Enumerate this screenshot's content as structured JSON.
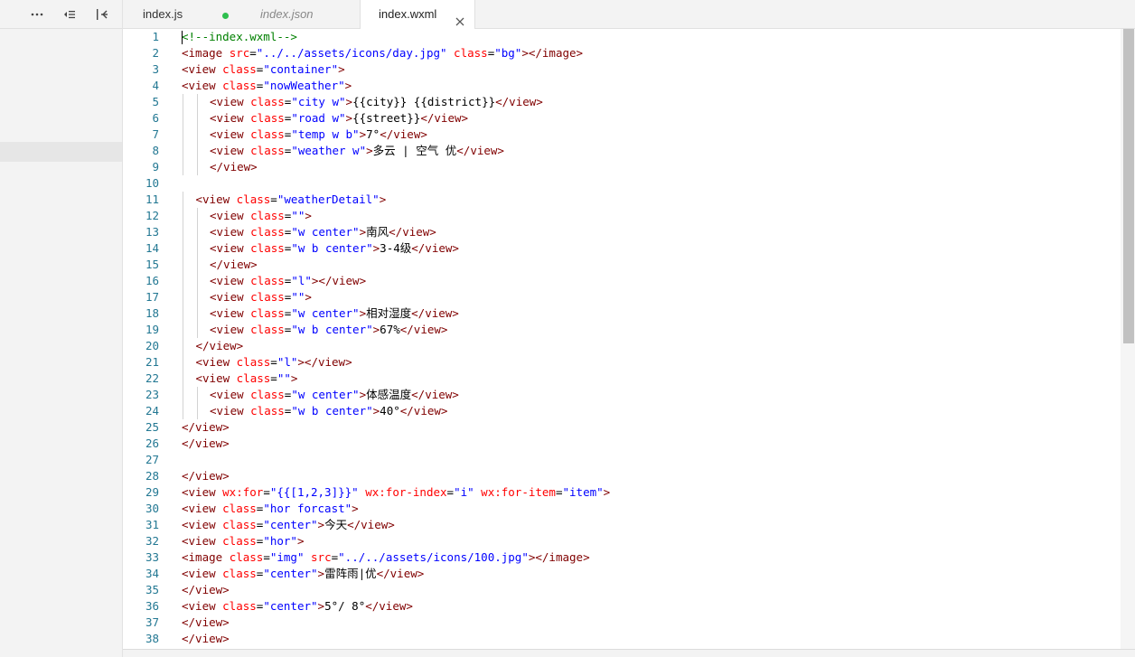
{
  "tabs": [
    {
      "label": "index.js",
      "modified": true,
      "modified_color": "#2dbf4e"
    },
    {
      "label": "index.json",
      "preview": true
    },
    {
      "label": "index.wxml",
      "active": true,
      "closable": true
    }
  ],
  "left_toolbar": {
    "icons": [
      "more-icon",
      "collapse-all-icon",
      "toggle-panel-icon"
    ]
  },
  "editor": {
    "cursor_line": 1,
    "colors": {
      "comment": "#008000",
      "tag": "#800000",
      "attribute": "#ff0000",
      "string": "#0000ff",
      "line_number": "#237893"
    },
    "lines": [
      {
        "n": "1",
        "i": 0,
        "t": [
          [
            "c",
            "<!--index.wxml-->"
          ]
        ]
      },
      {
        "n": "2",
        "i": 0,
        "t": [
          [
            "g",
            "<image "
          ],
          [
            "a",
            "src"
          ],
          [
            "x",
            "="
          ],
          [
            "s",
            "\"../../assets/icons/day.jpg\""
          ],
          [
            "x",
            " "
          ],
          [
            "a",
            "class"
          ],
          [
            "x",
            "="
          ],
          [
            "s",
            "\"bg\""
          ],
          [
            "g",
            "></image>"
          ]
        ]
      },
      {
        "n": "3",
        "i": 0,
        "t": [
          [
            "g",
            "<view "
          ],
          [
            "a",
            "class"
          ],
          [
            "x",
            "="
          ],
          [
            "s",
            "\"container\""
          ],
          [
            "g",
            ">"
          ]
        ]
      },
      {
        "n": "4",
        "i": 0,
        "t": [
          [
            "g",
            "<view "
          ],
          [
            "a",
            "class"
          ],
          [
            "x",
            "="
          ],
          [
            "s",
            "\"nowWeather\""
          ],
          [
            "g",
            ">"
          ]
        ]
      },
      {
        "n": "5",
        "i": 2,
        "t": [
          [
            "g",
            "<view "
          ],
          [
            "a",
            "class"
          ],
          [
            "x",
            "="
          ],
          [
            "s",
            "\"city w\""
          ],
          [
            "g",
            ">"
          ],
          [
            "x",
            "{{city}} {{district}}"
          ],
          [
            "g",
            "</view>"
          ]
        ]
      },
      {
        "n": "6",
        "i": 2,
        "t": [
          [
            "g",
            "<view "
          ],
          [
            "a",
            "class"
          ],
          [
            "x",
            "="
          ],
          [
            "s",
            "\"road w\""
          ],
          [
            "g",
            ">"
          ],
          [
            "x",
            "{{street}}"
          ],
          [
            "g",
            "</view>"
          ]
        ]
      },
      {
        "n": "7",
        "i": 2,
        "t": [
          [
            "g",
            "<view "
          ],
          [
            "a",
            "class"
          ],
          [
            "x",
            "="
          ],
          [
            "s",
            "\"temp w b\""
          ],
          [
            "g",
            ">"
          ],
          [
            "x",
            "7°"
          ],
          [
            "g",
            "</view>"
          ]
        ]
      },
      {
        "n": "8",
        "i": 2,
        "t": [
          [
            "g",
            "<view "
          ],
          [
            "a",
            "class"
          ],
          [
            "x",
            "="
          ],
          [
            "s",
            "\"weather w\""
          ],
          [
            "g",
            ">"
          ],
          [
            "x",
            "多云 | 空气 优"
          ],
          [
            "g",
            "</view>"
          ]
        ]
      },
      {
        "n": "9",
        "i": 2,
        "t": [
          [
            "g",
            "</view>"
          ]
        ]
      },
      {
        "n": "10",
        "i": 0,
        "t": []
      },
      {
        "n": "11",
        "i": 1,
        "t": [
          [
            "g",
            "<view "
          ],
          [
            "a",
            "class"
          ],
          [
            "x",
            "="
          ],
          [
            "s",
            "\"weatherDetail\""
          ],
          [
            "g",
            ">"
          ]
        ]
      },
      {
        "n": "12",
        "i": 2,
        "t": [
          [
            "g",
            "<view "
          ],
          [
            "a",
            "class"
          ],
          [
            "x",
            "="
          ],
          [
            "s",
            "\"\""
          ],
          [
            "g",
            ">"
          ]
        ]
      },
      {
        "n": "13",
        "i": 2,
        "t": [
          [
            "g",
            "<view "
          ],
          [
            "a",
            "class"
          ],
          [
            "x",
            "="
          ],
          [
            "s",
            "\"w center\""
          ],
          [
            "g",
            ">"
          ],
          [
            "x",
            "南风"
          ],
          [
            "g",
            "</view>"
          ]
        ]
      },
      {
        "n": "14",
        "i": 2,
        "t": [
          [
            "g",
            "<view "
          ],
          [
            "a",
            "class"
          ],
          [
            "x",
            "="
          ],
          [
            "s",
            "\"w b center\""
          ],
          [
            "g",
            ">"
          ],
          [
            "x",
            "3-4级"
          ],
          [
            "g",
            "</view>"
          ]
        ]
      },
      {
        "n": "15",
        "i": 2,
        "t": [
          [
            "g",
            "</view>"
          ]
        ]
      },
      {
        "n": "16",
        "i": 2,
        "t": [
          [
            "g",
            "<view "
          ],
          [
            "a",
            "class"
          ],
          [
            "x",
            "="
          ],
          [
            "s",
            "\"l\""
          ],
          [
            "g",
            "></view>"
          ]
        ]
      },
      {
        "n": "17",
        "i": 2,
        "t": [
          [
            "g",
            "<view "
          ],
          [
            "a",
            "class"
          ],
          [
            "x",
            "="
          ],
          [
            "s",
            "\"\""
          ],
          [
            "g",
            ">"
          ]
        ]
      },
      {
        "n": "18",
        "i": 2,
        "t": [
          [
            "g",
            "<view "
          ],
          [
            "a",
            "class"
          ],
          [
            "x",
            "="
          ],
          [
            "s",
            "\"w center\""
          ],
          [
            "g",
            ">"
          ],
          [
            "x",
            "相对湿度"
          ],
          [
            "g",
            "</view>"
          ]
        ]
      },
      {
        "n": "19",
        "i": 2,
        "t": [
          [
            "g",
            "<view "
          ],
          [
            "a",
            "class"
          ],
          [
            "x",
            "="
          ],
          [
            "s",
            "\"w b center\""
          ],
          [
            "g",
            ">"
          ],
          [
            "x",
            "67%"
          ],
          [
            "g",
            "</view>"
          ]
        ]
      },
      {
        "n": "20",
        "i": 1,
        "t": [
          [
            "g",
            "</view>"
          ]
        ]
      },
      {
        "n": "21",
        "i": 1,
        "t": [
          [
            "g",
            "<view "
          ],
          [
            "a",
            "class"
          ],
          [
            "x",
            "="
          ],
          [
            "s",
            "\"l\""
          ],
          [
            "g",
            "></view>"
          ]
        ]
      },
      {
        "n": "22",
        "i": 1,
        "t": [
          [
            "g",
            "<view "
          ],
          [
            "a",
            "class"
          ],
          [
            "x",
            "="
          ],
          [
            "s",
            "\"\""
          ],
          [
            "g",
            ">"
          ]
        ]
      },
      {
        "n": "23",
        "i": 2,
        "t": [
          [
            "g",
            "<view "
          ],
          [
            "a",
            "class"
          ],
          [
            "x",
            "="
          ],
          [
            "s",
            "\"w center\""
          ],
          [
            "g",
            ">"
          ],
          [
            "x",
            "体感温度"
          ],
          [
            "g",
            "</view>"
          ]
        ]
      },
      {
        "n": "24",
        "i": 2,
        "t": [
          [
            "g",
            "<view "
          ],
          [
            "a",
            "class"
          ],
          [
            "x",
            "="
          ],
          [
            "s",
            "\"w b center\""
          ],
          [
            "g",
            ">"
          ],
          [
            "x",
            "40°"
          ],
          [
            "g",
            "</view>"
          ]
        ]
      },
      {
        "n": "25",
        "i": 0,
        "t": [
          [
            "g",
            "</view>"
          ]
        ]
      },
      {
        "n": "26",
        "i": 0,
        "t": [
          [
            "g",
            "</view>"
          ]
        ]
      },
      {
        "n": "27",
        "i": 0,
        "t": []
      },
      {
        "n": "28",
        "i": 0,
        "t": [
          [
            "g",
            "</view>"
          ]
        ]
      },
      {
        "n": "29",
        "i": 0,
        "t": [
          [
            "g",
            "<view "
          ],
          [
            "a",
            "wx:for"
          ],
          [
            "x",
            "="
          ],
          [
            "s",
            "\"{{[1,2,3]}}\""
          ],
          [
            "x",
            " "
          ],
          [
            "a",
            "wx:for-index"
          ],
          [
            "x",
            "="
          ],
          [
            "s",
            "\"i\""
          ],
          [
            "x",
            " "
          ],
          [
            "a",
            "wx:for-item"
          ],
          [
            "x",
            "="
          ],
          [
            "s",
            "\"item\""
          ],
          [
            "g",
            ">"
          ]
        ]
      },
      {
        "n": "30",
        "i": 0,
        "t": [
          [
            "g",
            "<view "
          ],
          [
            "a",
            "class"
          ],
          [
            "x",
            "="
          ],
          [
            "s",
            "\"hor forcast\""
          ],
          [
            "g",
            ">"
          ]
        ]
      },
      {
        "n": "31",
        "i": 0,
        "t": [
          [
            "g",
            "<view "
          ],
          [
            "a",
            "class"
          ],
          [
            "x",
            "="
          ],
          [
            "s",
            "\"center\""
          ],
          [
            "g",
            ">"
          ],
          [
            "x",
            "今天"
          ],
          [
            "g",
            "</view>"
          ]
        ]
      },
      {
        "n": "32",
        "i": 0,
        "t": [
          [
            "g",
            "<view "
          ],
          [
            "a",
            "class"
          ],
          [
            "x",
            "="
          ],
          [
            "s",
            "\"hor\""
          ],
          [
            "g",
            ">"
          ]
        ]
      },
      {
        "n": "33",
        "i": 0,
        "t": [
          [
            "g",
            "<image "
          ],
          [
            "a",
            "class"
          ],
          [
            "x",
            "="
          ],
          [
            "s",
            "\"img\""
          ],
          [
            "x",
            " "
          ],
          [
            "a",
            "src"
          ],
          [
            "x",
            "="
          ],
          [
            "s",
            "\"../../assets/icons/100.jpg\""
          ],
          [
            "g",
            "></image>"
          ]
        ]
      },
      {
        "n": "34",
        "i": 0,
        "t": [
          [
            "g",
            "<view "
          ],
          [
            "a",
            "class"
          ],
          [
            "x",
            "="
          ],
          [
            "s",
            "\"center\""
          ],
          [
            "g",
            ">"
          ],
          [
            "x",
            "雷阵雨|优"
          ],
          [
            "g",
            "</view>"
          ]
        ]
      },
      {
        "n": "35",
        "i": 0,
        "t": [
          [
            "g",
            "</view>"
          ]
        ]
      },
      {
        "n": "36",
        "i": 0,
        "t": [
          [
            "g",
            "<view "
          ],
          [
            "a",
            "class"
          ],
          [
            "x",
            "="
          ],
          [
            "s",
            "\"center\""
          ],
          [
            "g",
            ">"
          ],
          [
            "x",
            "5°/ 8°"
          ],
          [
            "g",
            "</view>"
          ]
        ]
      },
      {
        "n": "37",
        "i": 0,
        "t": [
          [
            "g",
            "</view>"
          ]
        ]
      },
      {
        "n": "38",
        "i": 0,
        "t": [
          [
            "g",
            "</view>"
          ]
        ]
      }
    ]
  }
}
